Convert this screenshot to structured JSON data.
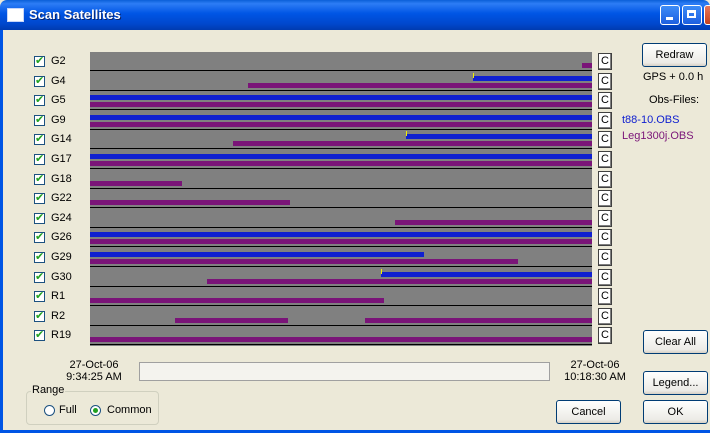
{
  "window": {
    "title": "Scan Satellites"
  },
  "satellites": [
    {
      "name": "G2",
      "checked": true
    },
    {
      "name": "G4",
      "checked": true
    },
    {
      "name": "G5",
      "checked": true
    },
    {
      "name": "G9",
      "checked": true
    },
    {
      "name": "G14",
      "checked": true
    },
    {
      "name": "G17",
      "checked": true
    },
    {
      "name": "G18",
      "checked": true
    },
    {
      "name": "G22",
      "checked": true
    },
    {
      "name": "G24",
      "checked": true
    },
    {
      "name": "G26",
      "checked": true
    },
    {
      "name": "G29",
      "checked": true
    },
    {
      "name": "G30",
      "checked": true
    },
    {
      "name": "R1",
      "checked": true
    },
    {
      "name": "R2",
      "checked": true
    },
    {
      "name": "R19",
      "checked": true
    }
  ],
  "coverage": [
    {
      "sat": "G2",
      "file1": [],
      "file2": [
        [
          0.981,
          1.0
        ]
      ],
      "ticks": []
    },
    {
      "sat": "G4",
      "file1": [
        [
          0.763,
          1.0
        ]
      ],
      "file2": [
        [
          0.315,
          1.0
        ]
      ],
      "ticks": [
        0.763
      ]
    },
    {
      "sat": "G5",
      "file1": [
        [
          0.0,
          1.0
        ]
      ],
      "file2": [
        [
          0.0,
          1.0
        ]
      ],
      "ticks": []
    },
    {
      "sat": "G9",
      "file1": [
        [
          0.0,
          1.0
        ]
      ],
      "file2": [
        [
          0.0,
          1.0
        ]
      ],
      "ticks": []
    },
    {
      "sat": "G14",
      "file1": [
        [
          0.629,
          1.0
        ]
      ],
      "file2": [
        [
          0.285,
          1.0
        ]
      ],
      "ticks": [
        0.629
      ]
    },
    {
      "sat": "G17",
      "file1": [
        [
          0.0,
          1.0
        ]
      ],
      "file2": [
        [
          0.0,
          1.0
        ]
      ],
      "ticks": []
    },
    {
      "sat": "G18",
      "file1": [],
      "file2": [
        [
          0.0,
          0.183
        ]
      ],
      "ticks": []
    },
    {
      "sat": "G22",
      "file1": [],
      "file2": [
        [
          0.0,
          0.398
        ]
      ],
      "ticks": []
    },
    {
      "sat": "G24",
      "file1": [],
      "file2": [
        [
          0.608,
          1.0
        ]
      ],
      "ticks": []
    },
    {
      "sat": "G26",
      "file1": [
        [
          0.0,
          1.0
        ]
      ],
      "file2": [
        [
          0.0,
          1.0
        ]
      ],
      "ticks": []
    },
    {
      "sat": "G29",
      "file1": [
        [
          0.0,
          0.665
        ]
      ],
      "file2": [
        [
          0.0,
          0.853
        ]
      ],
      "ticks": []
    },
    {
      "sat": "G30",
      "file1": [
        [
          0.58,
          1.0
        ]
      ],
      "file2": [
        [
          0.233,
          1.0
        ]
      ],
      "ticks": [
        0.58
      ]
    },
    {
      "sat": "R1",
      "file1": [],
      "file2": [
        [
          0.0,
          0.586
        ]
      ],
      "ticks": []
    },
    {
      "sat": "R2",
      "file1": [],
      "file2": [
        [
          0.169,
          0.394
        ],
        [
          0.548,
          1.0
        ]
      ],
      "ticks": []
    },
    {
      "sat": "R19",
      "file1": [],
      "file2": [
        [
          0.0,
          1.0
        ]
      ],
      "ticks": []
    }
  ],
  "row_button_label": "C",
  "side": {
    "redraw_label": "Redraw",
    "gps_offset": "GPS + 0.0 h",
    "obs_files_label": "Obs-Files:",
    "obs_files": [
      {
        "name": "t88-10.OBS",
        "color": "#1020d0"
      },
      {
        "name": "Leg1300j.OBS",
        "color": "#7a1478"
      }
    ],
    "clear_all_label": "Clear All",
    "legend_label": "Legend...",
    "ok_label": "OK"
  },
  "time": {
    "start_date": "27-Oct-06",
    "start_time": "9:34:25 AM",
    "end_date": "27-Oct-06",
    "end_time": "10:18:30 AM"
  },
  "range": {
    "label": "Range",
    "full_label": "Full",
    "common_label": "Common",
    "selected": "Common"
  },
  "cancel_label": "Cancel",
  "colors": {
    "file1": "#1020d0",
    "file2": "#7a1478",
    "plot_bg": "#808080",
    "tick": "#f0f000"
  }
}
